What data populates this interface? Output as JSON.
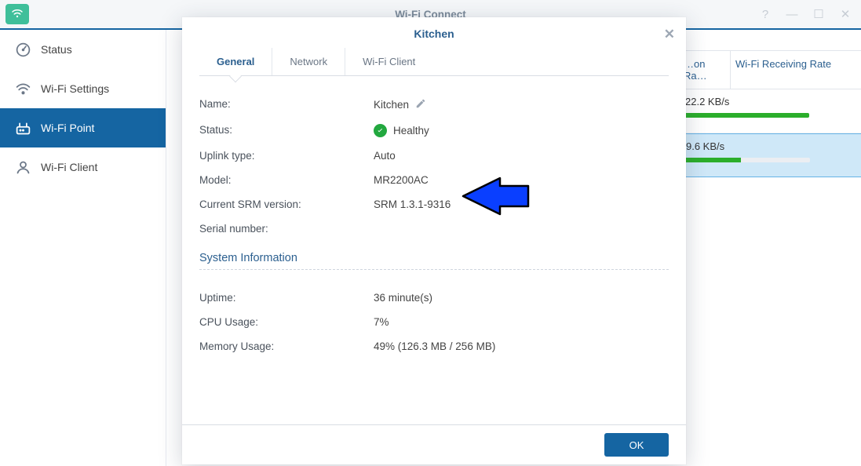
{
  "window": {
    "title": "Wi-Fi Connect"
  },
  "sidebar": {
    "items": [
      {
        "label": "Status",
        "icon": "gauge"
      },
      {
        "label": "Wi-Fi Settings",
        "icon": "wifi"
      },
      {
        "label": "Wi-Fi Point",
        "icon": "router",
        "active": true
      },
      {
        "label": "Wi-Fi Client",
        "icon": "user"
      }
    ]
  },
  "table": {
    "partial_header_a": "…on Ra…",
    "header_receiving": "Wi-Fi Receiving Rate",
    "rows": [
      {
        "rate_text": "22.2 KB/s",
        "bar_pct": 100
      },
      {
        "rate_text": "9.6 KB/s",
        "bar_pct": 45,
        "selected": true
      }
    ]
  },
  "modal": {
    "title": "Kitchen",
    "tabs": [
      {
        "label": "General",
        "active": true
      },
      {
        "label": "Network"
      },
      {
        "label": "Wi-Fi Client"
      }
    ],
    "fields": {
      "name_label": "Name:",
      "name_value": "Kitchen",
      "status_label": "Status:",
      "status_value": "Healthy",
      "uplink_label": "Uplink type:",
      "uplink_value": "Auto",
      "model_label": "Model:",
      "model_value": "MR2200AC",
      "srm_label": "Current SRM version:",
      "srm_value": "SRM 1.3.1-9316",
      "serial_label": "Serial number:",
      "serial_value": ""
    },
    "section_title": "System Information",
    "system_info": {
      "uptime_label": "Uptime:",
      "uptime_value": "36 minute(s)",
      "cpu_label": "CPU Usage:",
      "cpu_value": "7%",
      "mem_label": "Memory Usage:",
      "mem_value": "49% (126.3 MB / 256 MB)"
    },
    "ok_label": "OK"
  },
  "annotation": {
    "type": "arrow",
    "color": "#0a3fff",
    "points_to": "srm_version"
  }
}
